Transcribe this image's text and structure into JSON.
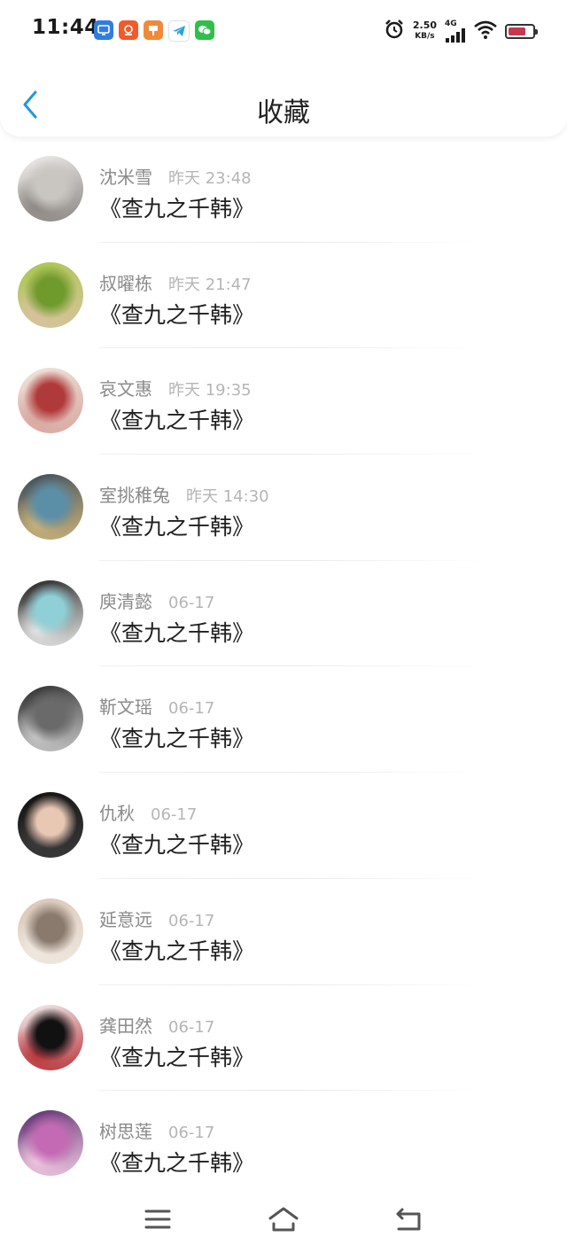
{
  "status_bar": {
    "time": "11:44",
    "network_speed_value": "2.50",
    "network_speed_unit": "KB/s",
    "network_type": "4G",
    "notification_icons": [
      "screen-mirror-icon",
      "news-app-icon",
      "orange-app-icon",
      "telegram-icon",
      "wechat-icon"
    ],
    "alarm_icon": "alarm-clock-icon",
    "battery_color": "#c8384f",
    "battery_level": 0.72
  },
  "header": {
    "title": "收藏",
    "back_icon": "chevron-left-icon",
    "accent_color": "#2196e6"
  },
  "favorites": [
    {
      "author": "沈米雪",
      "time": "昨天 23:48",
      "title": "《查九之千韩》",
      "avatar_colors": [
        "#f2f0ee",
        "#c9c5c0",
        "#8b8682"
      ]
    },
    {
      "author": "叔曜栋",
      "time": "昨天 21:47",
      "title": "《查九之千韩》",
      "avatar_colors": [
        "#a8c84a",
        "#6f9a2c",
        "#d9c2a0"
      ]
    },
    {
      "author": "哀文惠",
      "time": "昨天 19:35",
      "title": "《查九之千韩》",
      "avatar_colors": [
        "#efe6dc",
        "#b03a3a",
        "#d8a7a0"
      ]
    },
    {
      "author": "室挑稚兔",
      "time": "昨天 14:30",
      "title": "《查九之千韩》",
      "avatar_colors": [
        "#3a4a5a",
        "#5b8fa8",
        "#c9b27a"
      ]
    },
    {
      "author": "庾清懿",
      "time": "06-17",
      "title": "《查九之千韩》",
      "avatar_colors": [
        "#1f1f1f",
        "#8fd0d6",
        "#e6e6e6"
      ]
    },
    {
      "author": "靳文瑶",
      "time": "06-17",
      "title": "《查九之千韩》",
      "avatar_colors": [
        "#2a2a2a",
        "#6a6a6a",
        "#c8c8c8"
      ]
    },
    {
      "author": "仇秋",
      "time": "06-17",
      "title": "《查九之千韩》",
      "avatar_colors": [
        "#111111",
        "#e8c7b3",
        "#3a3a3a"
      ]
    },
    {
      "author": "延意远",
      "time": "06-17",
      "title": "《查九之千韩》",
      "avatar_colors": [
        "#d9c6b5",
        "#8a7a6e",
        "#f0e8e0"
      ]
    },
    {
      "author": "龚田然",
      "time": "06-17",
      "title": "《查九之千韩》",
      "avatar_colors": [
        "#f4f4f4",
        "#111111",
        "#b8343a"
      ]
    },
    {
      "author": "树思莲",
      "time": "06-17",
      "title": "《查九之千韩》",
      "avatar_colors": [
        "#5a2a6e",
        "#c46ab4",
        "#f0c8e0"
      ]
    }
  ],
  "nav_bar": {
    "menu_icon": "menu-icon",
    "home_icon": "home-icon",
    "back_icon": "back-arrow-icon"
  }
}
